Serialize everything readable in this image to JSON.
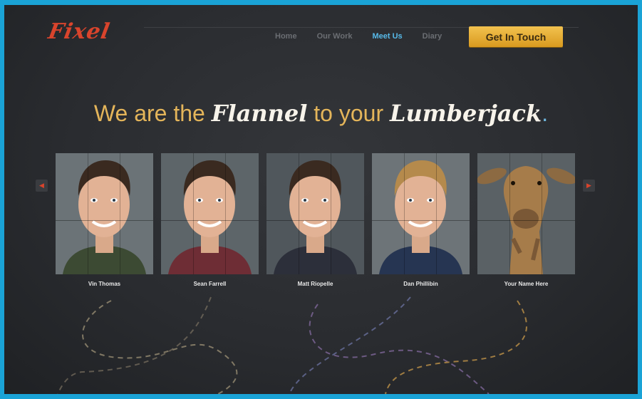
{
  "logo": "Fixel",
  "nav": {
    "items": [
      "Home",
      "Our Work",
      "Meet Us",
      "Diary"
    ],
    "active": "Meet Us"
  },
  "cta": {
    "label": "Get In Touch"
  },
  "headline": {
    "part1": "We are the ",
    "script1": "Flannel",
    "part2": " to your ",
    "script2": "Lumberjack",
    "dot": "."
  },
  "carousel": {
    "prev_icon": "arrow-left-icon",
    "next_icon": "arrow-right-icon",
    "members": [
      {
        "name": "Vin Thomas",
        "shirt": "#3c4a33",
        "bg": "#6b7377"
      },
      {
        "name": "Sean Farrell",
        "shirt": "#6e2d35",
        "bg": "#5d6569"
      },
      {
        "name": "Matt Riopelle",
        "shirt": "#2c2f3a",
        "bg": "#50575c"
      },
      {
        "name": "Dan Phillibin",
        "shirt": "#263552",
        "bg": "#6d7478"
      },
      {
        "name": "Your Name Here",
        "shirt": "#000000",
        "bg": "#5a6165"
      }
    ]
  },
  "colors": {
    "accent": "#e4b55a",
    "logo": "#d9442c",
    "nav_active": "#57b9e8",
    "background": "#2a2c30",
    "border": "#1aa3d6"
  }
}
